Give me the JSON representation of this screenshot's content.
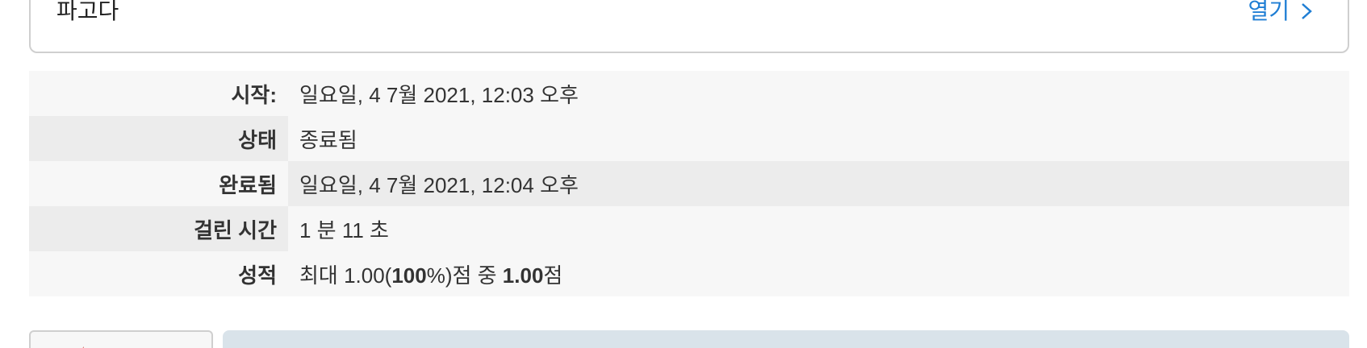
{
  "top_card": {
    "title": "파고다",
    "open_label": "열기"
  },
  "summary": {
    "rows": [
      {
        "label": "시작:",
        "value": "일요일, 4 7월 2021, 12:03 오후"
      },
      {
        "label": "상태",
        "value": "종료됨"
      },
      {
        "label": "완료됨",
        "value": "일요일, 4 7월 2021, 12:04 오후"
      },
      {
        "label": "걸린 시간",
        "value": "1 분 11 초"
      },
      {
        "label": "성적",
        "grade": {
          "prefix": "최대 1.00(",
          "percent": "100",
          "mid": "%)점 중 ",
          "score": "1.00",
          "suffix": "점"
        }
      }
    ]
  },
  "colors": {
    "link": "#1f7ed4",
    "flag": "#c0392b",
    "info_box": "#d9e3ea"
  },
  "icons": {
    "open_chevron": "chevron-right-icon",
    "flag": "flag-icon"
  }
}
